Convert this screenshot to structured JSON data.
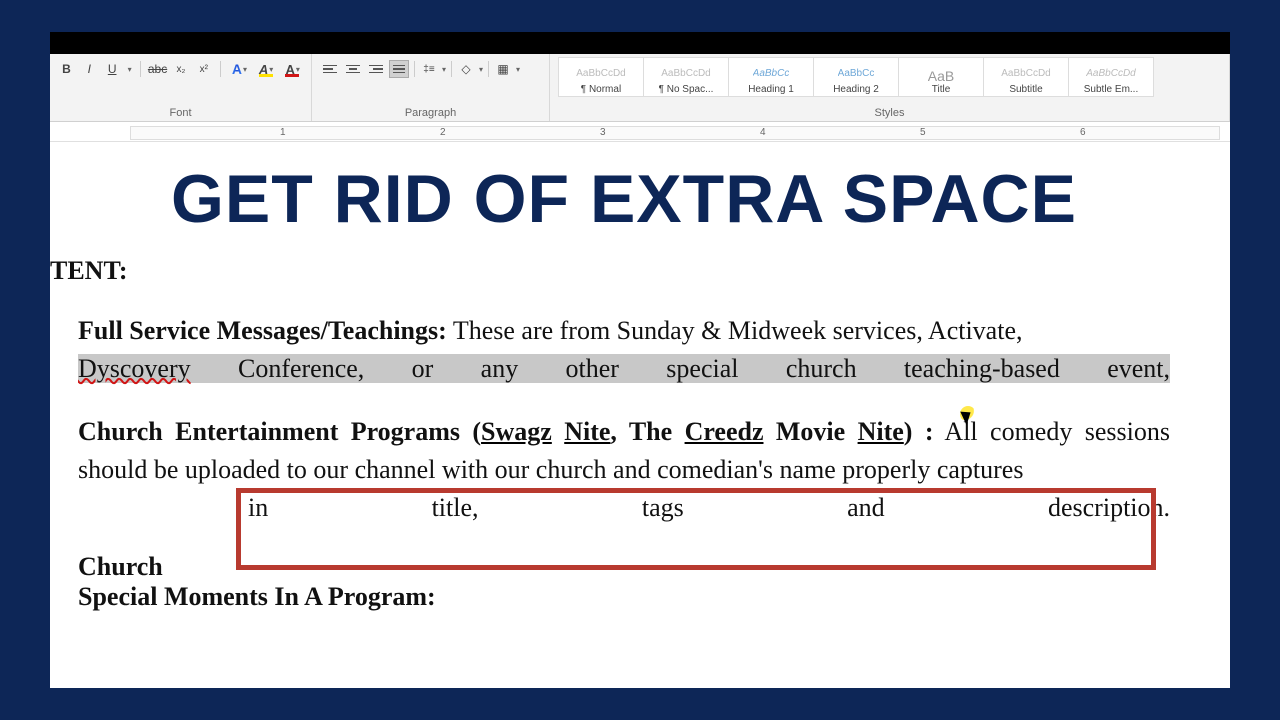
{
  "ribbon": {
    "font_label": "Font",
    "para_label": "Paragraph",
    "styles_label": "Styles",
    "bold": "B",
    "italic": "I",
    "underline": "U",
    "strike": "abc",
    "sub": "x₂",
    "sup": "x²",
    "texteffect": "A",
    "highlight": "A",
    "fontcolor": "A",
    "styles": [
      "¶ Normal",
      "¶ No Spac...",
      "Heading 1",
      "Heading 2",
      "Title",
      "Subtitle",
      "Subtle Em..."
    ]
  },
  "ruler": {
    "marks": [
      "1",
      "2",
      "3",
      "4",
      "5",
      "6"
    ]
  },
  "overlay": {
    "title": "GET RID OF EXTRA SPACE"
  },
  "doc": {
    "tent": "TENT:",
    "p1_bold": "Full Service Messages/Teachings:",
    "p1_rest_a": " These are from Sunday & Midweek services, Activate, ",
    "p1_sel_word1": "Dyscovery",
    "p1_sel_rest": "   Conference,   or   any   other   special   church   teaching-based   event,",
    "p2_bold_a": "Church Entertainment Programs (",
    "p2_u1": "Swagz",
    "p2_sp1": " ",
    "p2_u2": "Nite",
    "p2_mid": ", The ",
    "p2_u3": "Creedz",
    "p2_sp2": " Movie ",
    "p2_u4": "Nite",
    "p2_bold_b": ") :",
    "p2_rest1": " All comedy sessions should be uploaded to our channel with our church and comedian's name properly captures",
    "p2_just_words": [
      "in",
      "title,",
      "tags",
      "and",
      "description."
    ],
    "h_church": "Church",
    "h_special": "Special Moments In A Program:"
  }
}
